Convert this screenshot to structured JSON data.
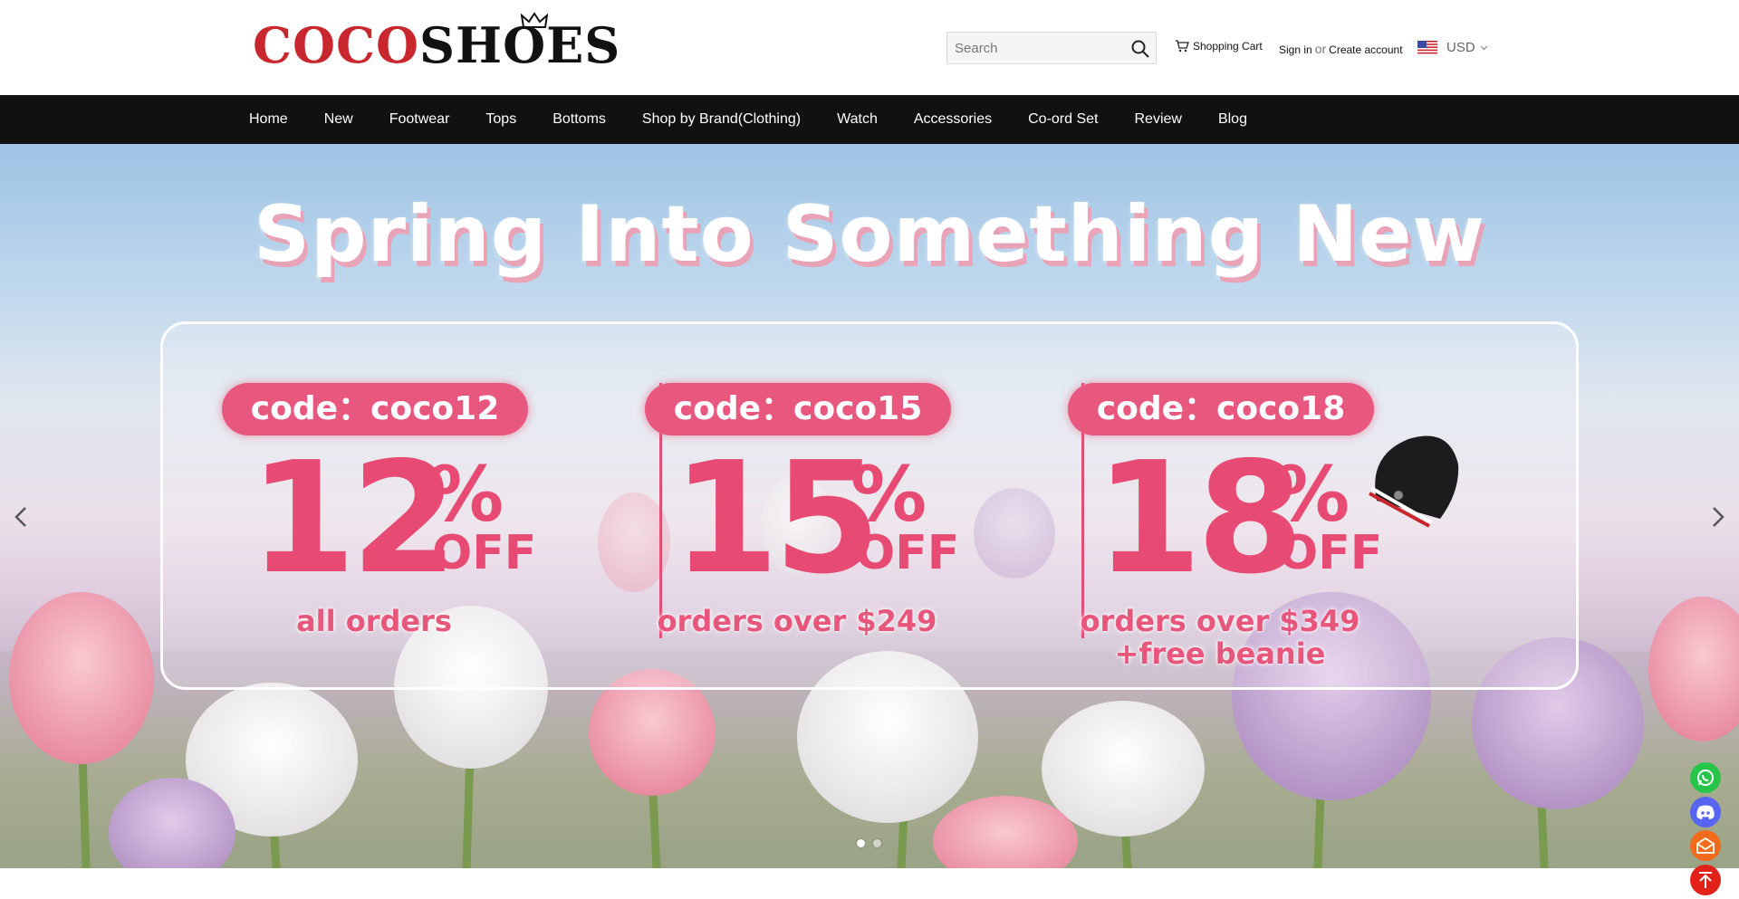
{
  "brand": {
    "logo_part1": "COCO",
    "logo_part2": "SHOES"
  },
  "header": {
    "search_placeholder": "Search",
    "cart_label": "Shopping Cart",
    "sign_in": "Sign in",
    "or": "or",
    "create_account": "Create account",
    "currency": "USD"
  },
  "nav": {
    "items": [
      {
        "label": "Home"
      },
      {
        "label": "New"
      },
      {
        "label": "Footwear"
      },
      {
        "label": "Tops"
      },
      {
        "label": "Bottoms"
      },
      {
        "label": "Shop by Brand(Clothing)"
      },
      {
        "label": "Watch"
      },
      {
        "label": "Accessories"
      },
      {
        "label": "Co-ord Set"
      },
      {
        "label": "Review"
      },
      {
        "label": "Blog"
      }
    ]
  },
  "hero": {
    "title": "Spring Into Something New",
    "promos": [
      {
        "code": "code：coco12",
        "number": "12",
        "percent": "%",
        "off": "OFF",
        "condition": "all orders"
      },
      {
        "code": "code：coco15",
        "number": "15",
        "percent": "%",
        "off": "OFF",
        "condition": "orders over $249"
      },
      {
        "code": "code：coco18",
        "number": "18",
        "percent": "%",
        "off": "OFF",
        "condition": "orders over $349\n+free beanie"
      }
    ],
    "slide_count": 2,
    "active_slide": 1
  },
  "colors": {
    "nav_bg": "#111111",
    "promo_pink": "#e74a72",
    "whatsapp": "#27c54a",
    "discord": "#5865f2",
    "mail": "#f26a1b",
    "back_to_top": "#e0221b"
  },
  "floating": {
    "icons": [
      "whatsapp-icon",
      "discord-icon",
      "mail-icon",
      "arrow-up-icon"
    ]
  }
}
